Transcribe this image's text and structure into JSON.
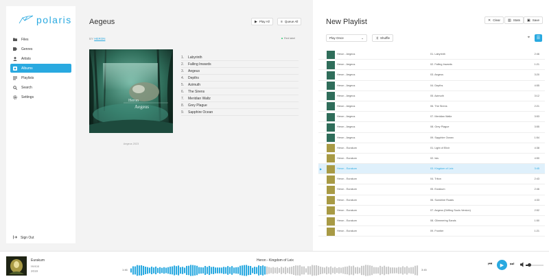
{
  "sidebar": {
    "brand": "polaris",
    "items": [
      {
        "label": "Files",
        "icon": "folder-icon"
      },
      {
        "label": "Genres",
        "icon": "tag-icon"
      },
      {
        "label": "Artists",
        "icon": "person-icon"
      },
      {
        "label": "Albums",
        "icon": "album-icon",
        "active": true
      },
      {
        "label": "Playlists",
        "icon": "playlist-icon"
      },
      {
        "label": "Search",
        "icon": "search-icon"
      },
      {
        "label": "Settings",
        "icon": "gear-icon"
      }
    ],
    "signout_label": "Sign Out"
  },
  "album": {
    "title": "Aegeus",
    "play_all_label": "Play All",
    "queue_all_label": "Queue All",
    "by_label": "BY",
    "artist": "HERON",
    "badge": "Red label",
    "cover_text_top": "Heron",
    "cover_text_bottom": "Aegeus",
    "cover_caption": "Aegeus 2023",
    "tracks": [
      {
        "num": "1.",
        "title": "Labyrinth"
      },
      {
        "num": "2.",
        "title": "Falling Inwards"
      },
      {
        "num": "3.",
        "title": "Aegeus"
      },
      {
        "num": "4.",
        "title": "Depths"
      },
      {
        "num": "5.",
        "title": "Azimuth"
      },
      {
        "num": "6.",
        "title": "The Sirens"
      },
      {
        "num": "7.",
        "title": "Meridian Waltz"
      },
      {
        "num": "8.",
        "title": "Grey Plague"
      },
      {
        "num": "9.",
        "title": "Sapphire Ocean"
      }
    ]
  },
  "playlist": {
    "title": "New Playlist",
    "clear_label": "Clear",
    "stats_label": "Stats",
    "save_label": "Save",
    "play_order": "Play Once",
    "shuffle_label": "Shuffle",
    "rows": [
      {
        "artist": "Heron - Aegeus",
        "title": "01. Labyrinth",
        "duration": "2:46",
        "art": "aegeus"
      },
      {
        "artist": "Heron - Aegeus",
        "title": "02. Falling Inwards",
        "duration": "1:21",
        "art": "aegeus"
      },
      {
        "artist": "Heron - Aegeus",
        "title": "03. Aegeus",
        "duration": "3:20",
        "art": "aegeus"
      },
      {
        "artist": "Heron - Aegeus",
        "title": "04. Depths",
        "duration": "4:55",
        "art": "aegeus"
      },
      {
        "artist": "Heron - Aegeus",
        "title": "05. Azimuth",
        "duration": "3:12",
        "art": "aegeus"
      },
      {
        "artist": "Heron - Aegeus",
        "title": "06. The Sirens",
        "duration": "2:21",
        "art": "aegeus"
      },
      {
        "artist": "Heron - Aegeus",
        "title": "07. Meridian Waltz",
        "duration": "3:53",
        "art": "aegeus"
      },
      {
        "artist": "Heron - Aegeus",
        "title": "08. Grey Plague",
        "duration": "3:55",
        "art": "aegeus"
      },
      {
        "artist": "Heron - Aegeus",
        "title": "09. Sapphire Ocean",
        "duration": "1:54",
        "art": "aegeus"
      },
      {
        "artist": "Heron - Eurakum",
        "title": "01. Light of Elixir",
        "duration": "4:38",
        "art": "eurakum"
      },
      {
        "artist": "Heron - Eurakum",
        "title": "02. Isis",
        "duration": "4:50",
        "art": "eurakum"
      },
      {
        "artist": "Heron - Eurakum",
        "title": "03. Kingdom of Leix",
        "duration": "3:45",
        "art": "eurakum",
        "current": true
      },
      {
        "artist": "Heron - Eurakum",
        "title": "04. Triton",
        "duration": "2:43",
        "art": "eurakum"
      },
      {
        "artist": "Heron - Eurakum",
        "title": "05. Eurakum",
        "duration": "2:46",
        "art": "eurakum"
      },
      {
        "artist": "Heron - Eurakum",
        "title": "06. Sunshine Roads",
        "duration": "4:33",
        "art": "eurakum"
      },
      {
        "artist": "Heron - Eurakum",
        "title": "07. Aegeus (Drifting Souls Version)",
        "duration": "2:52",
        "art": "eurakum"
      },
      {
        "artist": "Heron - Eurakum",
        "title": "08. Glimmering Sands",
        "duration": "1:50",
        "art": "eurakum"
      },
      {
        "artist": "Heron - Eurakum",
        "title": "09. Frontier",
        "duration": "1:21",
        "art": "eurakum"
      }
    ]
  },
  "player": {
    "title": "Eurakum",
    "artist": "Heron",
    "year": "2019",
    "now_playing": "Heron - Kingdom of Leix",
    "elapsed": "1:46",
    "total": "3:45",
    "progress": 0.47,
    "volume": 0.2
  },
  "colors": {
    "accent": "#29a9e0",
    "aegeus_art": "#2f6d5a",
    "eurakum_art": "#a89a45"
  }
}
